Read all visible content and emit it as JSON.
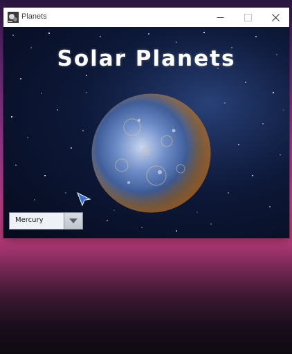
{
  "window": {
    "title": "Planets",
    "app_icon": "planets-app-icon",
    "controls": {
      "minimize_icon": "minimize-icon",
      "maximize_icon": "maximize-icon",
      "close_icon": "close-icon"
    }
  },
  "main": {
    "heading": "Solar Planets",
    "planet_image": "mercury-planet-image",
    "planet_selector": {
      "selected": "Mercury",
      "arrow_icon": "chevron-down-icon"
    }
  },
  "colors": {
    "title_text": "#444444",
    "heading_text": "#ffffff",
    "space_background": "#0d1838",
    "combo_background": "#eef1f5"
  }
}
